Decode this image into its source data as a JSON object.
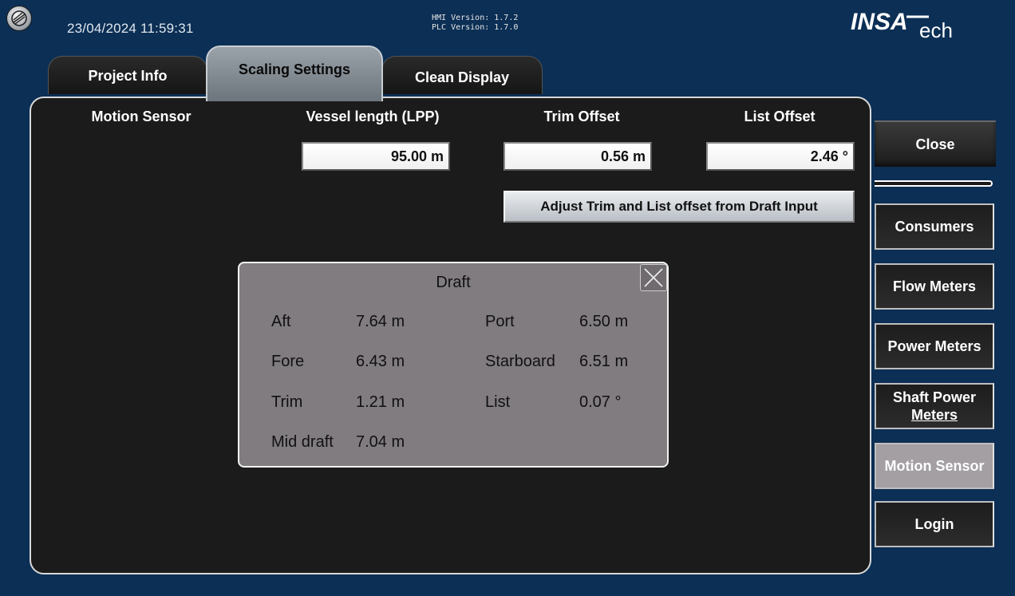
{
  "header": {
    "datetime": "23/04/2024 11:59:31",
    "hmi_version": "HMI Version: 1.7.2",
    "plc_version": "PLC Version: 1.7.0",
    "brand": "INSATech",
    "brand_logo_text": "INSA",
    "brand_suffix": "ech"
  },
  "tabs": [
    {
      "label": "Project Info",
      "active": false
    },
    {
      "label": "Scaling Settings",
      "active": true
    },
    {
      "label": "Clean Display",
      "active": false
    }
  ],
  "panel": {
    "motion_sensor_label": "Motion Sensor",
    "vessel_length": {
      "label": "Vessel length (LPP)",
      "value": "95.00 m"
    },
    "trim_offset": {
      "label": "Trim Offset",
      "value": "0.56 m"
    },
    "list_offset": {
      "label": "List Offset",
      "value": "2.46 °"
    },
    "adjust_button": "Adjust Trim and List offset from Draft Input"
  },
  "draft_dialog": {
    "title": "Draft",
    "close_icon": "close-icon",
    "rows": [
      {
        "label": "Aft",
        "value": "7.64 m"
      },
      {
        "label": "Fore",
        "value": "6.43 m"
      },
      {
        "label": "Trim",
        "value": "1.21 m"
      },
      {
        "label": "Mid draft",
        "value": "7.04 m"
      }
    ],
    "right_rows": [
      {
        "label": "Port",
        "value": "6.50 m"
      },
      {
        "label": "Starboard",
        "value": "6.51 m"
      },
      {
        "label": "List",
        "value": "0.07 °"
      }
    ]
  },
  "side_nav": {
    "close": "Close",
    "items": [
      {
        "label": "Consumers"
      },
      {
        "label": "Flow Meters"
      },
      {
        "label": "Power Meters"
      },
      {
        "label_line1": "Shaft Power",
        "label_line2": "Meters"
      },
      {
        "label": "Motion Sensor",
        "active": true
      },
      {
        "label": "Login"
      }
    ]
  },
  "colors": {
    "background": "#0c2f55",
    "panel": "#1b1b1b",
    "dialog": "#807c80",
    "active_tab": "#8a9198",
    "active_nav": "#a39fa3"
  }
}
